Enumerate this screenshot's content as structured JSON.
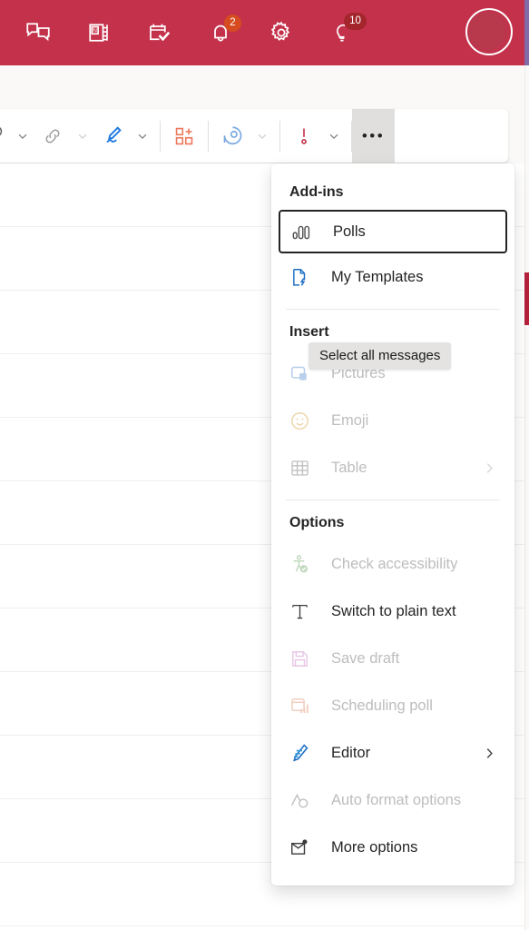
{
  "appbar": {
    "background_color": "#c4314b",
    "items": [
      {
        "name": "chat-icon",
        "label": "Chat",
        "badge": null
      },
      {
        "name": "onenote-icon",
        "label": "OneNote",
        "badge": null
      },
      {
        "name": "tasks-icon",
        "label": "To Do",
        "badge": null
      },
      {
        "name": "notifications-bell-icon",
        "label": "Notifications",
        "badge": "2",
        "badge_color": "#d64b20"
      },
      {
        "name": "settings-gear-icon",
        "label": "Settings",
        "badge": null
      },
      {
        "name": "tips-lightbulb-icon",
        "label": "Tips",
        "badge": "10",
        "badge_color": "#a4262c"
      }
    ],
    "avatar_label": "Account manager"
  },
  "toolbar": {
    "items": [
      {
        "name": "attach-file-icon",
        "label": "Attach file",
        "type": "icon",
        "color": "#616161"
      },
      {
        "name": "attach-file-caret-icon",
        "label": "Attach file options",
        "type": "caret",
        "dim": false
      },
      {
        "name": "insert-link-icon",
        "label": "Link",
        "type": "icon",
        "color": "#9e9e9e"
      },
      {
        "name": "insert-link-caret-icon",
        "label": "Link options",
        "type": "caret",
        "dim": true
      },
      {
        "name": "signature-icon",
        "label": "Signature",
        "type": "icon",
        "color": "#0f6cbd"
      },
      {
        "name": "signature-caret-icon",
        "label": "Signature options",
        "type": "caret",
        "dim": false
      },
      {
        "name": "apps-icon",
        "label": "Apps",
        "type": "icon",
        "color": "#ec7a5c"
      },
      {
        "name": "loop-component-icon",
        "label": "Loop components",
        "type": "icon",
        "color": "#7aa9e0"
      },
      {
        "name": "loop-caret-icon",
        "label": "Loop options",
        "type": "caret",
        "dim": true
      },
      {
        "name": "importance-icon",
        "label": "High importance",
        "type": "icon",
        "color": "#c4314b"
      },
      {
        "name": "importance-caret-icon",
        "label": "Importance options",
        "type": "caret",
        "dim": false
      },
      {
        "name": "more-options-dots-button",
        "label": "More options",
        "type": "dots",
        "glyph": "•••",
        "active": true
      }
    ],
    "expand_label": "Show more commands"
  },
  "tooltip": {
    "text": "Select all messages"
  },
  "menu": {
    "sections": [
      {
        "heading": "Add-ins",
        "items": [
          {
            "label": "Polls",
            "icon": "poll-bars-icon",
            "disabled": false,
            "focused": true,
            "submenu": false
          },
          {
            "label": "My Templates",
            "icon": "my-templates-icon",
            "disabled": false,
            "focused": false,
            "submenu": false
          }
        ],
        "divider_after": true
      },
      {
        "heading": "Insert",
        "items": [
          {
            "label": "Pictures",
            "icon": "pictures-icon",
            "disabled": true,
            "focused": false,
            "submenu": false
          },
          {
            "label": "Emoji",
            "icon": "emoji-icon",
            "disabled": true,
            "focused": false,
            "submenu": false
          },
          {
            "label": "Table",
            "icon": "table-icon",
            "disabled": true,
            "focused": false,
            "submenu": true
          }
        ],
        "divider_after": true
      },
      {
        "heading": "Options",
        "items": [
          {
            "label": "Check accessibility",
            "icon": "accessibility-icon",
            "disabled": true,
            "focused": false,
            "submenu": false
          },
          {
            "label": "Switch to plain text",
            "icon": "plain-text-icon",
            "disabled": false,
            "focused": false,
            "submenu": false
          },
          {
            "label": "Save draft",
            "icon": "save-draft-icon",
            "disabled": true,
            "focused": false,
            "submenu": false
          },
          {
            "label": "Scheduling poll",
            "icon": "scheduling-poll-icon",
            "disabled": true,
            "focused": false,
            "submenu": false
          },
          {
            "label": "Editor",
            "icon": "editor-icon",
            "disabled": false,
            "focused": false,
            "submenu": true
          },
          {
            "label": "Auto format options",
            "icon": "auto-format-icon",
            "disabled": true,
            "focused": false,
            "submenu": false
          },
          {
            "label": "More options",
            "icon": "message-options-icon",
            "disabled": false,
            "focused": false,
            "submenu": false
          }
        ],
        "divider_after": false
      }
    ]
  },
  "mail_list": {
    "rows": [
      "",
      "",
      "",
      "",
      "",
      "",
      "",
      "",
      "",
      "",
      "",
      ""
    ]
  }
}
